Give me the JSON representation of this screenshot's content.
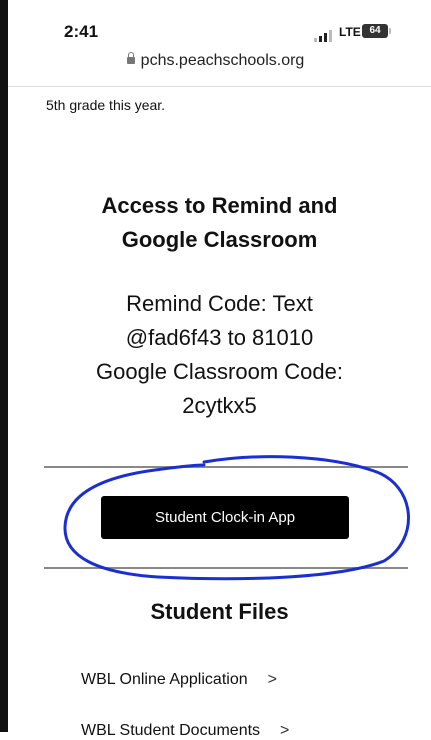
{
  "status_bar": {
    "time": "2:41",
    "network": "LTE",
    "battery": "64"
  },
  "browser": {
    "url": "pchs.peachschools.org"
  },
  "intro_text": "5th grade this year.",
  "access_section": {
    "title_line1": "Access to Remind and",
    "title_line2": "Google Classroom",
    "code_lines": [
      "Remind Code: Text",
      "@fad6f43 to 81010",
      "Google Classroom Code:",
      "2cytkx5"
    ]
  },
  "clockin_button_label": "Student Clock-in App",
  "annotation_color": "#1a2fd1",
  "student_files": {
    "title": "Student Files",
    "links": [
      {
        "label": "WBL Online Application",
        "chevron": ">"
      },
      {
        "label": "WBL Student Documents",
        "chevron": ">"
      }
    ]
  }
}
